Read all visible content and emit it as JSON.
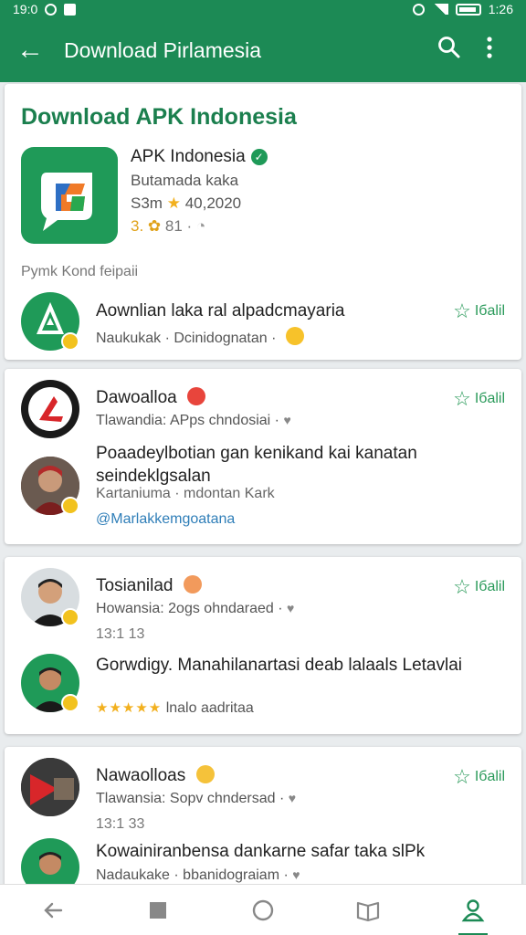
{
  "status_bar": {
    "time": "19:0",
    "battery": "1:26"
  },
  "app_bar": {
    "title": "Download Pirlamesia"
  },
  "featured": {
    "section_title": "Download APK Indonesia",
    "app_name": "APK Indonesia",
    "developer": "Butamada kaka",
    "meta_prefix": "S3m",
    "meta_date": "40,2020",
    "rating": "3.",
    "downloads": "81 ·",
    "caption": "Pymk Kond feipaii",
    "row_title": "Aownlian laka ral alpadcmayaria",
    "row_sub": "Naukukak · Dcinidognatan ·",
    "follow_label": "Iбalil"
  },
  "posts": [
    {
      "title": "Dawoalloa",
      "sub": "Tlawandia: APps chndosiai ·",
      "comment_text": "Poaadeylbotian gan kenikand kai kanatan seindeklgsalan",
      "comment_sub": "Kartaniuma · mdontan Kark",
      "mention": "@Marlakkemgoatana",
      "follow_label": "Iбalil"
    },
    {
      "title": "Tosianilad",
      "sub": "Howansia: 2ogs ohndaraed ·",
      "time": "13:1 13",
      "comment_text": "Gorwdigy. Manahilanartasi deab lalaals Letavlai",
      "rating_label": "lnalo aadritaa",
      "follow_label": "Iбalil"
    },
    {
      "title": "Nawaolloas",
      "sub": "Tlawansia: Sopv chndersad ·",
      "time": "13:1 33",
      "comment_text": "Kowainiranbensa dankarne safar taka slPk",
      "comment_sub": "Nadaukake · bbanidograiam ·",
      "follow_label": "Iбalil"
    }
  ],
  "colors": {
    "primary": "#1c8a55",
    "accent_star": "#f2b01e",
    "mention": "#2f7eb8"
  }
}
